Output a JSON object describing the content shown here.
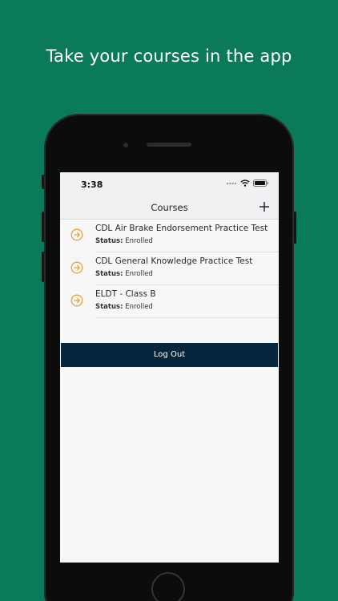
{
  "headline": "Take your courses in the app",
  "status_bar": {
    "time": "3:38"
  },
  "nav": {
    "title": "Courses",
    "add_icon": "plus-icon"
  },
  "courses": [
    {
      "title": "CDL Air Brake Endorsement Practice Test",
      "status_label": "Status:",
      "status_value": "Enrolled",
      "icon": "arrow-right-circle-icon"
    },
    {
      "title": "CDL General Knowledge Practice Test",
      "status_label": "Status:",
      "status_value": "Enrolled",
      "icon": "arrow-right-circle-icon"
    },
    {
      "title": "ELDT - Class B",
      "status_label": "Status:",
      "status_value": "Enrolled",
      "icon": "arrow-right-circle-icon"
    }
  ],
  "logout_label": "Log Out",
  "colors": {
    "background": "#0a7a5a",
    "accent_icon": "#e8a23a",
    "logout_button": "#06263d"
  }
}
